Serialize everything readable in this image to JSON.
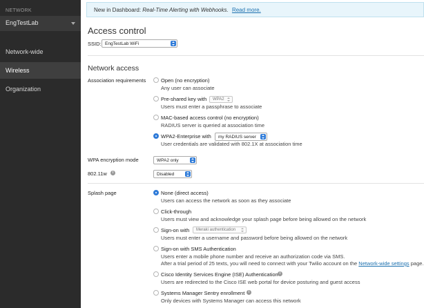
{
  "sidebar": {
    "network_label": "NETWORK",
    "network_name": "EngTestLab",
    "items": [
      {
        "label": "Network-wide"
      },
      {
        "label": "Wireless"
      },
      {
        "label": "Organization"
      }
    ]
  },
  "banner": {
    "prefix": "New in Dashboard:",
    "feature": "Real-Time Alerting with Webhooks.",
    "link": "Read more."
  },
  "page": {
    "title": "Access control",
    "ssid_label": "SSID:",
    "ssid_value": "EngTestLab WiFi"
  },
  "network_access": {
    "heading": "Network access",
    "assoc_label": "Association requirements",
    "options": [
      {
        "title": "Open (no encryption)",
        "desc": "Any user can associate"
      },
      {
        "title": "Pre-shared key with",
        "select": "WPA2",
        "desc": "Users must enter a passphrase to associate"
      },
      {
        "title": "MAC-based access control (no encryption)",
        "desc": "RADIUS server is queried at association time"
      },
      {
        "title": "WPA2-Enterprise with",
        "select": "my RADIUS server",
        "desc": "User credentials are validated with 802.1X at association time"
      }
    ],
    "wpa_label": "WPA encryption mode",
    "wpa_value": "WPA2 only",
    "dot11w_label": "802.11w",
    "dot11w_value": "Disabled"
  },
  "splash": {
    "label": "Splash page",
    "options": [
      {
        "title": "None (direct access)",
        "desc": "Users can access the network as soon as they associate"
      },
      {
        "title": "Click-through",
        "desc": "Users must view and acknowledge your splash page before being allowed on the network"
      },
      {
        "title": "Sign-on with",
        "select": "Meraki authentication",
        "desc": "Users must enter a username and password before being allowed on the network"
      },
      {
        "title": "Sign-on with SMS Authentication",
        "desc": "Users enter a mobile phone number and receive an authorization code via SMS.",
        "desc2_before": "After a trial period of 25 texts, you will need to connect with your Twilio account on the ",
        "desc2_link": "Network-wide settings",
        "desc2_after": " page."
      },
      {
        "title": "Cisco Identity Services Engine (ISE) Authentication",
        "desc": "Users are redirected to the Cisco ISE web portal for device posturing and guest access"
      },
      {
        "title": "Systems Manager Sentry enrollment",
        "desc": "Only devices with Systems Manager can access this network"
      }
    ]
  }
}
